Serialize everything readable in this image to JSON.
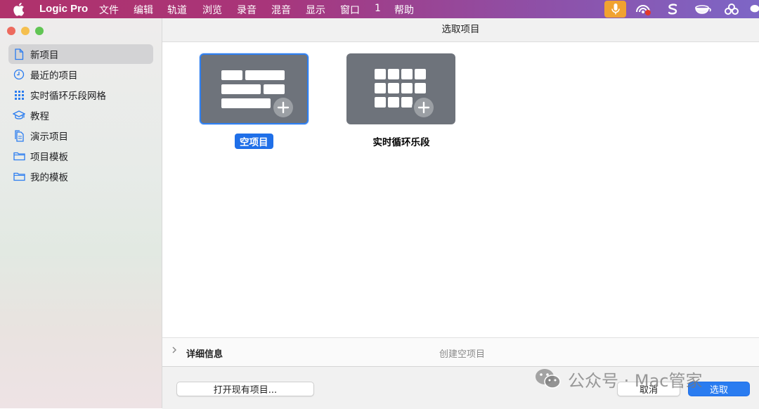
{
  "menubar": {
    "app_name": "Logic Pro",
    "items": [
      "文件",
      "编辑",
      "轨道",
      "浏览",
      "录音",
      "混音",
      "显示",
      "窗口",
      "1",
      "帮助"
    ],
    "status_icons": [
      "microphone-icon",
      "record-status-icon",
      "scribble-icon",
      "teacup-icon",
      "link-rings-icon",
      "wechat-icon"
    ]
  },
  "sidebar": {
    "items": [
      {
        "label": "新项目",
        "icon": "document-icon",
        "selected": true
      },
      {
        "label": "最近的项目",
        "icon": "clock-icon",
        "selected": false
      },
      {
        "label": "实时循环乐段网格",
        "icon": "grid-icon",
        "selected": false
      },
      {
        "label": "教程",
        "icon": "graduation-cap-icon",
        "selected": false
      },
      {
        "label": "演示项目",
        "icon": "documents-icon",
        "selected": false
      },
      {
        "label": "项目模板",
        "icon": "folder-icon",
        "selected": false
      },
      {
        "label": "我的模板",
        "icon": "folder-icon",
        "selected": false
      }
    ]
  },
  "window": {
    "title": "选取项目"
  },
  "templates": [
    {
      "label": "空项目",
      "selected": true
    },
    {
      "label": "实时循环乐段",
      "selected": false
    }
  ],
  "details": {
    "toggle_label": "详细信息",
    "description": "创建空项目"
  },
  "footer": {
    "open_existing_label": "打开现有项目...",
    "cancel_label": "取消",
    "choose_label": "选取"
  },
  "watermark": "公众号 · Mac管家",
  "colors": {
    "accent": "#2a7cf0",
    "tile_gray": "#6e737b",
    "menubar_start": "#b0326b",
    "menubar_end": "#7d66c6",
    "mic_orange": "#f1a230"
  }
}
